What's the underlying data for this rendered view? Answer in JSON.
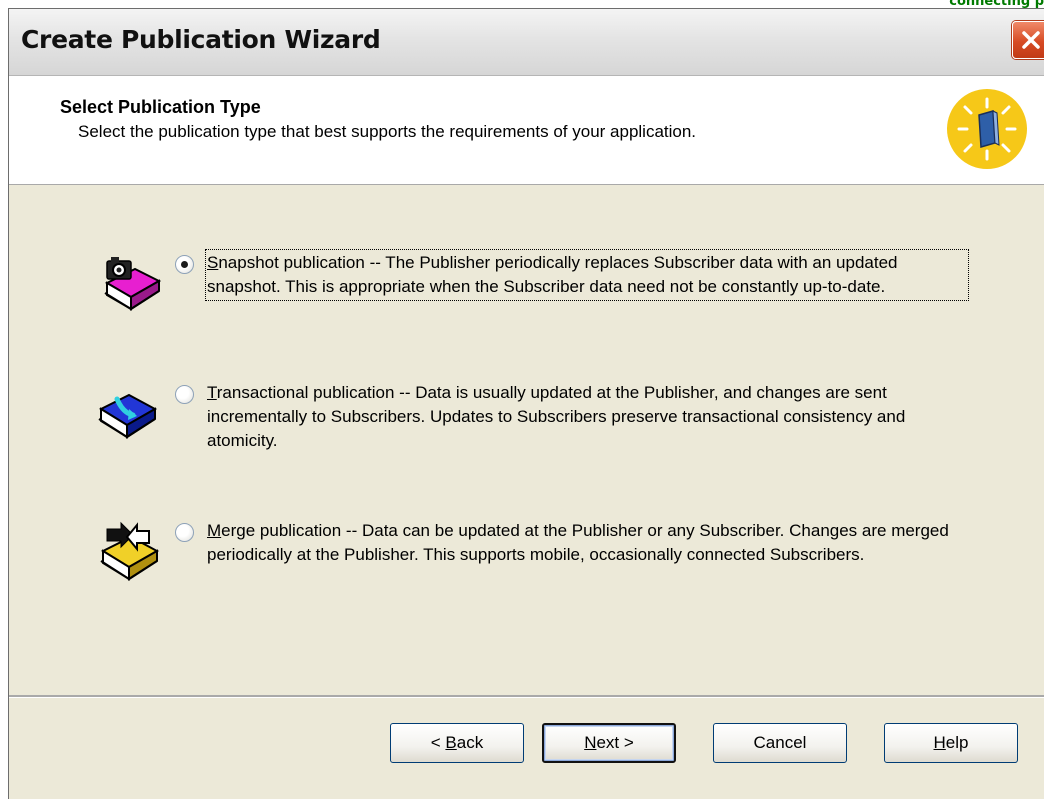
{
  "page_corner_text": "connecting p",
  "window": {
    "title": "Create Publication Wizard"
  },
  "header": {
    "title": "Select Publication Type",
    "subtitle": "Select the publication type that best supports the requirements of your application."
  },
  "options": [
    {
      "mnemonic": "S",
      "label_rest": "napshot publication -- The Publisher periodically replaces Subscriber data with an updated snapshot. This is appropriate when the Subscriber data need not be constantly up-to-date.",
      "selected": true,
      "icon": "snapshot-book-icon"
    },
    {
      "mnemonic": "T",
      "label_rest": "ransactional publication -- Data is usually updated at the Publisher, and changes are sent incrementally to Subscribers. Updates to Subscribers preserve transactional consistency and atomicity.",
      "selected": false,
      "icon": "transactional-book-icon"
    },
    {
      "mnemonic": "M",
      "label_rest": "erge publication -- Data can be updated at the Publisher or any Subscriber. Changes are merged periodically at the Publisher. This supports mobile, occasionally connected Subscribers.",
      "selected": false,
      "icon": "merge-book-icon"
    }
  ],
  "buttons": {
    "back": {
      "prefix": "< ",
      "mnemonic": "B",
      "rest": "ack"
    },
    "next": {
      "mnemonic": "N",
      "rest": "ext >"
    },
    "cancel": {
      "label": "Cancel"
    },
    "help": {
      "mnemonic": "H",
      "rest": "elp"
    }
  },
  "colors": {
    "dialog_bg": "#ECE9D8",
    "header_bg": "#FFFFFF",
    "close_button": "#D74B24",
    "button_border": "#003C74"
  }
}
